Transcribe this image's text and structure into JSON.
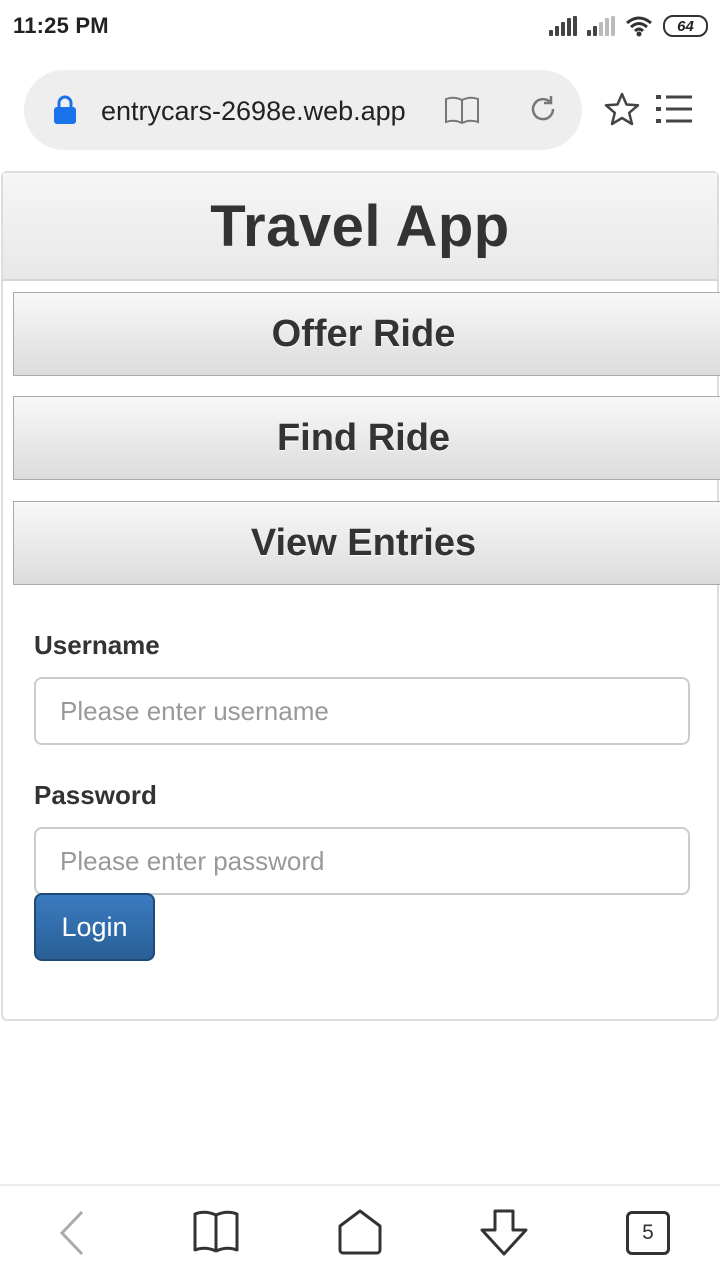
{
  "status_bar": {
    "time": "11:25 PM",
    "battery": "64",
    "icons": [
      "signal-icon",
      "signal-icon",
      "wifi-icon",
      "battery-icon"
    ]
  },
  "browser": {
    "url": "entrycars-2698e.web.app",
    "icons": [
      "lock-icon",
      "reader-icon",
      "reload-icon",
      "star-icon",
      "menu-icon"
    ]
  },
  "app": {
    "title": "Travel App",
    "nav": [
      {
        "label": "Offer Ride"
      },
      {
        "label": "Find Ride"
      },
      {
        "label": "View Entries"
      }
    ],
    "form": {
      "username_label": "Username",
      "username_placeholder": "Please enter username",
      "username_value": "",
      "password_label": "Password",
      "password_placeholder": "Please enter password",
      "password_value": "",
      "login_label": "Login"
    }
  },
  "bottom_bar": {
    "tabs_count": "5",
    "icons": [
      "back-icon",
      "bookmarks-icon",
      "home-icon",
      "download-icon",
      "tabs-icon"
    ]
  },
  "colors": {
    "login_button": "#2f6ca8",
    "lock": "#1a73e8"
  }
}
